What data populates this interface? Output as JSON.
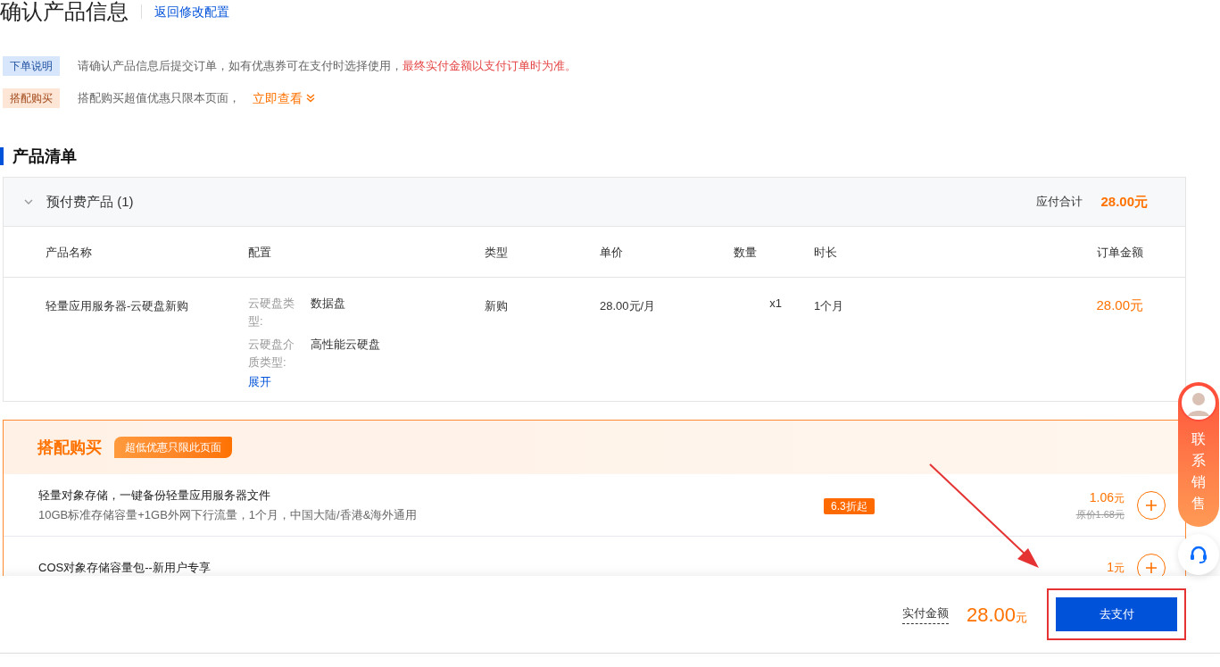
{
  "page_title": "确认产品信息",
  "back_link": "返回修改配置",
  "notices": [
    {
      "kind": "info",
      "tag": "下单说明",
      "text": "请确认产品信息后提交订单，如有优惠券可在支付时选择使用，",
      "highlight": "最终实付金额以支付订单时为准。"
    },
    {
      "kind": "promo",
      "tag": "搭配购买",
      "text": "搭配购买超值优惠只限本页面，",
      "link": "立即查看"
    }
  ],
  "section_title": "产品清单",
  "group": {
    "title": "预付费产品 (1)",
    "expanded": true,
    "total_label": "应付合计",
    "total": "28.00元"
  },
  "table": {
    "columns": [
      "产品名称",
      "配置",
      "类型",
      "单价",
      "数量",
      "时长",
      "订单金额"
    ],
    "rows": [
      {
        "name": "轻量应用服务器-云硬盘新购",
        "config": [
          {
            "label": "云硬盘类型:",
            "value": "数据盘"
          },
          {
            "label": "云硬盘介质类型:",
            "value": "高性能云硬盘"
          }
        ],
        "expand": "展开",
        "type": "新购",
        "unit_price": "28.00元/月",
        "quantity": "x1",
        "duration": "1个月",
        "amount": "28.00元"
      }
    ]
  },
  "combo": {
    "title": "搭配购买",
    "badge": "超低优惠只限此页面",
    "items": [
      {
        "title": "轻量对象存储，一键备份轻量应用服务器文件",
        "desc": "10GB标准存储容量+1GB外网下行流量，1个月，中国大陆/香港&海外通用",
        "discount": "6.3折起",
        "price": "1.06",
        "unit": "元",
        "original": "原价1.68元"
      },
      {
        "title": "COS对象存储容量包--新用户专享",
        "price": "1",
        "unit": "元"
      }
    ]
  },
  "footer": {
    "label": "实付金额",
    "amount": "28.00",
    "unit": "元",
    "pay_button": "去支付"
  },
  "contact": {
    "label": "联系销售"
  }
}
